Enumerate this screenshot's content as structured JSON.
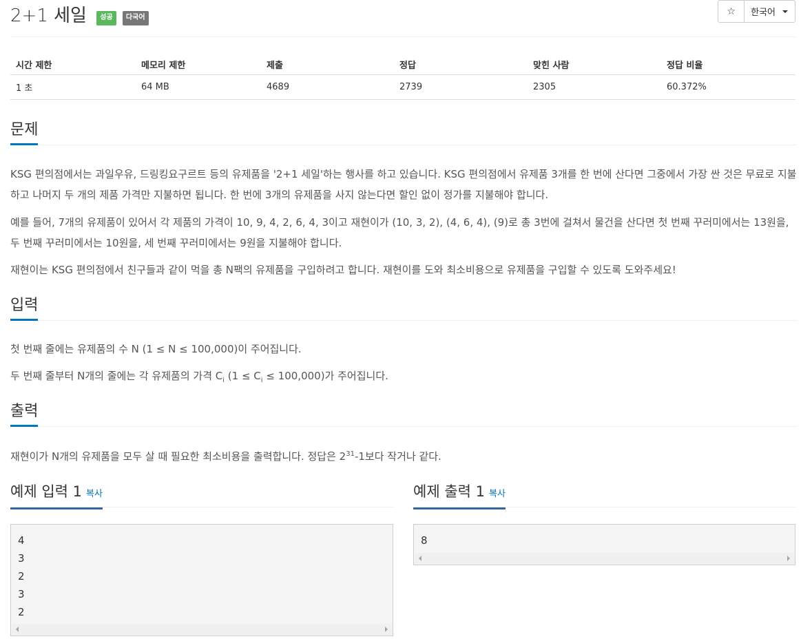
{
  "problem": {
    "title": "2+1 세일",
    "badges": [
      "성공",
      "다국어"
    ]
  },
  "toolbar": {
    "star_glyph": "☆",
    "language": "한국어"
  },
  "stats": {
    "headers": [
      "시간 제한",
      "메모리 제한",
      "제출",
      "정답",
      "맞힌 사람",
      "정답 비율"
    ],
    "values": [
      "1 초",
      "64 MB",
      "4689",
      "2739",
      "2305",
      "60.372%"
    ]
  },
  "description": {
    "heading": "문제",
    "paragraphs": [
      "KSG 편의점에서는 과일우유, 드링킹요구르트 등의 유제품을 '2+1 세일'하는 행사를 하고 있습니다. KSG 편의점에서 유제품 3개를 한 번에 산다면 그중에서 가장 싼 것은 무료로 지불하고 나머지 두 개의 제품 가격만 지불하면 됩니다. 한 번에 3개의 유제품을 사지 않는다면 할인 없이 정가를 지불해야 합니다.",
      "예를 들어, 7개의 유제품이 있어서 각 제품의 가격이 10, 9, 4, 2, 6, 4, 3이고 재현이가 (10, 3, 2), (4, 6, 4), (9)로 총 3번에 걸쳐서 물건을 산다면 첫 번째 꾸러미에서는 13원을, 두 번째 꾸러미에서는 10원을, 세 번째 꾸러미에서는 9원을 지불해야 합니다.",
      "재현이는 KSG 편의점에서 친구들과 같이 먹을 총 N팩의 유제품을 구입하려고 합니다. 재현이를 도와 최소비용으로 유제품을 구입할 수 있도록 도와주세요!"
    ]
  },
  "input_section": {
    "heading": "입력",
    "line1": "첫 번째 줄에는 유제품의 수 N (1 ≤ N ≤ 100,000)이 주어집니다.",
    "line2_a": "두 번째 줄부터 N개의 줄에는 각 유제품의 가격 C",
    "line2_sub1": "i",
    "line2_b": " (1 ≤ C",
    "line2_sub2": "i",
    "line2_c": " ≤ 100,000)가 주어집니다."
  },
  "output_section": {
    "heading": "출력",
    "line_a": "재현이가 N개의 유제품을 모두 살 때 필요한 최소비용을 출력합니다. 정답은 2",
    "line_sup": "31",
    "line_b": "-1보다 작거나 같다."
  },
  "samples": {
    "input_title": "예제 입력 1",
    "output_title": "예제 출력 1",
    "copy_label": "복사",
    "input_text": "4\n3\n2\n3\n2",
    "output_text": "8"
  },
  "colors": {
    "badge_success": "#5cb85c",
    "badge_multilang": "#777777",
    "accent_underline": "#0076c0",
    "link": "#0076c0"
  }
}
